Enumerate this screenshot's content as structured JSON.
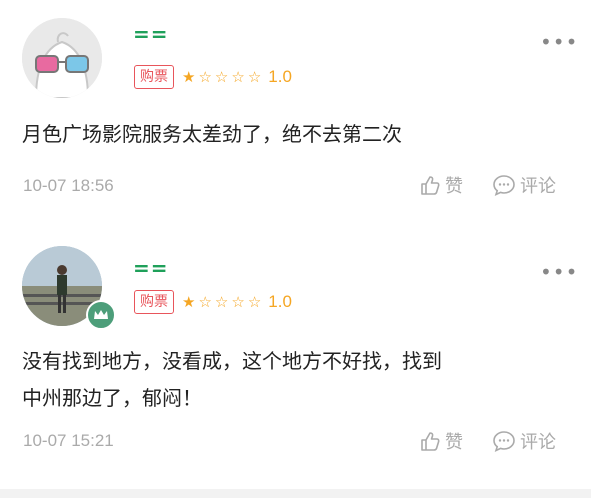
{
  "reviews": [
    {
      "username": "= =",
      "badge": "购票",
      "rating_stars": 1,
      "rating_max": 5,
      "score": "1.0",
      "content": "月色广场影院服务太差劲了，绝不去第二次",
      "time": "10-07 18:56",
      "like_label": "赞",
      "comment_label": "评论",
      "more": "•••"
    },
    {
      "username": "= =",
      "badge": "购票",
      "rating_stars": 1,
      "rating_max": 5,
      "score": "1.0",
      "content_line1": "没有找到地方，没看成，这个地方不好找，找到",
      "content_line2": "中州那边了，郁闷！",
      "time": "10-07 15:21",
      "like_label": "赞",
      "comment_label": "评论",
      "more": "•••"
    }
  ],
  "colors": {
    "accent": "#e8555b",
    "star": "#f5a623",
    "username": "#1fa05a",
    "muted": "#aaaaaa"
  }
}
